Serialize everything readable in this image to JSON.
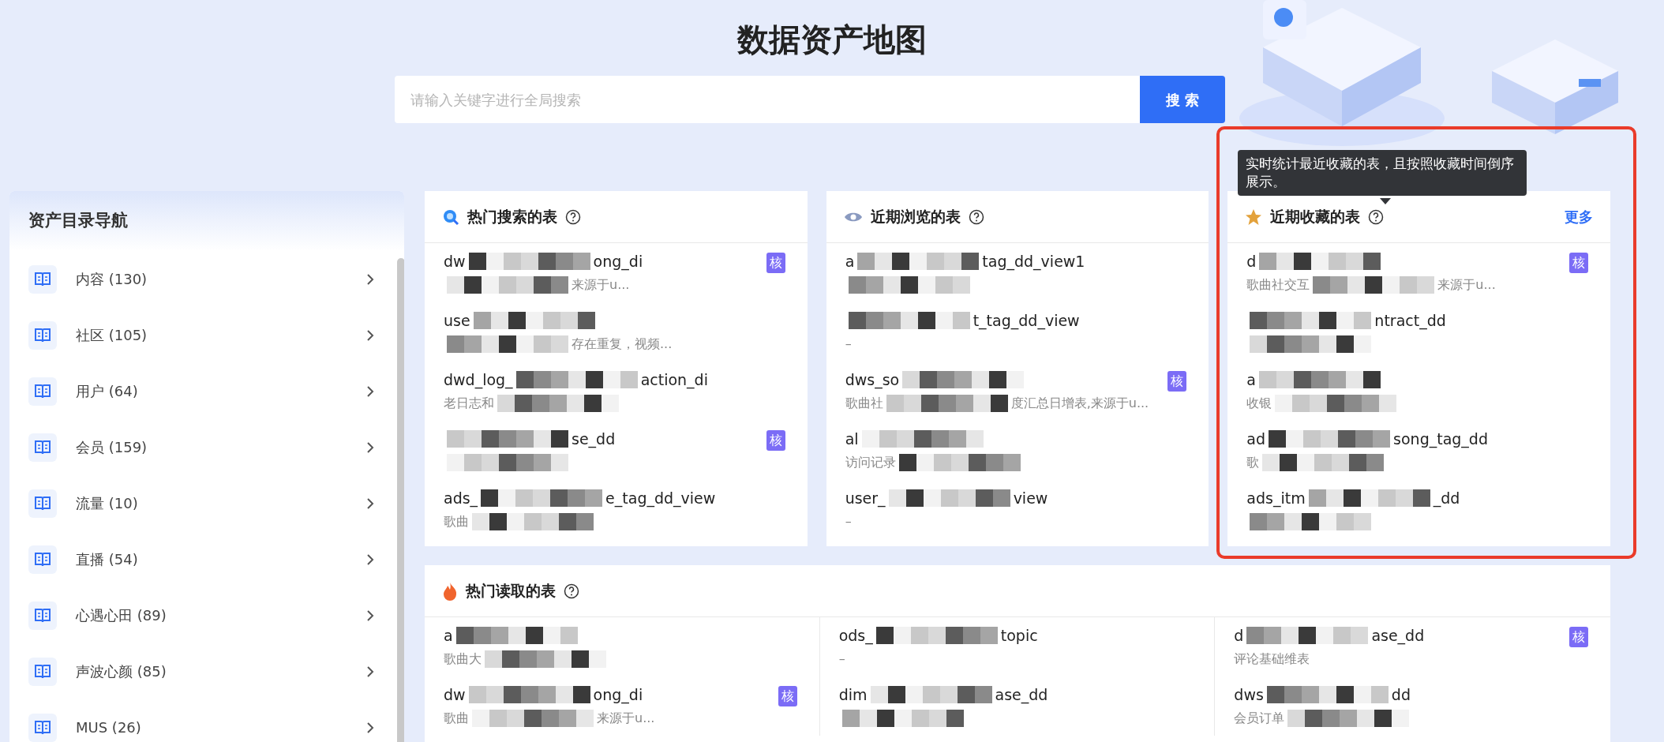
{
  "title": "数据资产地图",
  "search": {
    "placeholder": "请输入关键字进行全局搜索",
    "button": "搜 索"
  },
  "sidebar": {
    "title": "资产目录导航",
    "items": [
      {
        "label": "内容 (130)"
      },
      {
        "label": "社区 (105)"
      },
      {
        "label": "用户 (64)"
      },
      {
        "label": "会员 (159)"
      },
      {
        "label": "流量 (10)"
      },
      {
        "label": "直播 (54)"
      },
      {
        "label": "心遇心田 (89)"
      },
      {
        "label": "声波心颜 (85)"
      },
      {
        "label": "MUS (26)"
      }
    ]
  },
  "panels": [
    {
      "kind": "search",
      "title": "热门搜索的表",
      "rows": [
        {
          "name": {
            "head": "dw",
            "tail": "ong_di",
            "redacted": true
          },
          "desc": {
            "tail": "来源于u...",
            "redacted": true
          },
          "tag": "核"
        },
        {
          "name": {
            "head": "use",
            "redacted": true
          },
          "desc": {
            "tail": "存在重复，视频...",
            "redacted": true
          }
        },
        {
          "name": {
            "head": "dwd_log_",
            "tail": "action_di",
            "redacted": true
          },
          "desc": {
            "head": "老日志和",
            "redacted": true
          }
        },
        {
          "name": {
            "tail": "se_dd",
            "redacted": true
          },
          "desc": {
            "redacted": true
          },
          "tag": "核"
        },
        {
          "name": {
            "head": "ads_",
            "tail": "e_tag_dd_view",
            "redacted": true
          },
          "desc": {
            "head": "歌曲",
            "redacted": true
          }
        }
      ]
    },
    {
      "kind": "eye",
      "title": "近期浏览的表",
      "rows": [
        {
          "name": {
            "head": "a",
            "tail": "tag_dd_view1",
            "redacted": true
          },
          "desc": {
            "redacted": true
          }
        },
        {
          "name": {
            "tail": "t_tag_dd_view",
            "redacted": true
          },
          "desc": {
            "head": "–"
          }
        },
        {
          "name": {
            "head": "dws_so",
            "redacted": true
          },
          "desc": {
            "head": "歌曲社",
            "tail": "度汇总日增表,来源于u...",
            "redacted": true
          },
          "tag": "核"
        },
        {
          "name": {
            "head": "al",
            "redacted": true
          },
          "desc": {
            "head": "访问记录",
            "redacted": true
          }
        },
        {
          "name": {
            "head": "user_",
            "tail": "view",
            "redacted": true
          },
          "desc": {
            "head": "–"
          }
        }
      ]
    },
    {
      "kind": "star",
      "title": "近期收藏的表",
      "more": "更多",
      "rows": [
        {
          "name": {
            "head": "d",
            "redacted": true
          },
          "desc": {
            "head": "歌曲社交互",
            "tail": "来源于u...",
            "redacted": true
          },
          "tag": "核"
        },
        {
          "name": {
            "tail": "ntract_dd",
            "redacted": true
          },
          "desc": {
            "redacted": true
          }
        },
        {
          "name": {
            "head": "a",
            "redacted": true
          },
          "desc": {
            "head": "收银",
            "redacted": true
          }
        },
        {
          "name": {
            "head": "ad",
            "tail": "song_tag_dd",
            "redacted": true
          },
          "desc": {
            "head": "歌",
            "redacted": true
          }
        },
        {
          "name": {
            "head": "ads_itm",
            "tail": "_dd",
            "redacted": true
          },
          "desc": {
            "redacted": true
          }
        }
      ]
    }
  ],
  "hot_read": {
    "kind": "fire",
    "title": "热门读取的表",
    "columns": [
      {
        "rows": [
          {
            "name": {
              "head": "a",
              "redacted": true
            },
            "desc": {
              "head": "歌曲大",
              "redacted": true
            }
          },
          {
            "name": {
              "head": "dw",
              "tail": "ong_di",
              "redacted": true
            },
            "desc": {
              "head": "歌曲",
              "tail": "来源于u...",
              "redacted": true
            },
            "tag": "核"
          }
        ]
      },
      {
        "rows": [
          {
            "name": {
              "head": "ods_",
              "tail": "topic",
              "redacted": true
            },
            "desc": {
              "head": "–"
            }
          },
          {
            "name": {
              "head": "dim",
              "tail": "ase_dd",
              "redacted": true
            },
            "desc": {
              "redacted": true
            }
          }
        ]
      },
      {
        "rows": [
          {
            "name": {
              "head": "d",
              "tail": "ase_dd",
              "redacted": true
            },
            "desc": {
              "head": "评论基础维表"
            },
            "tag": "核"
          },
          {
            "name": {
              "head": "dws",
              "tail": "dd",
              "redacted": true
            },
            "desc": {
              "head": "会员订单",
              "redacted": true
            }
          }
        ]
      }
    ]
  },
  "tooltip": {
    "text": "实时统计最近收藏的表，且按照收藏时间倒序展示。"
  }
}
